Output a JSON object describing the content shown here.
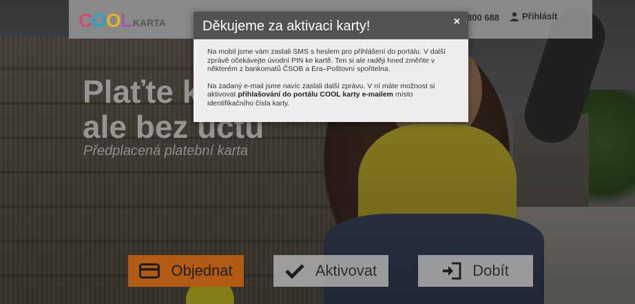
{
  "header": {
    "logo_cool": [
      "C",
      "O",
      "O",
      "L"
    ],
    "logo_karta": "KARTA",
    "phone": "800 688",
    "login_label": "Přihlásit"
  },
  "hero": {
    "title_line1": "Plaťte k",
    "title_line2": "ale bez účtu",
    "subtitle": "Předplacená platební karta"
  },
  "buttons": {
    "order": "Objednat",
    "activate": "Aktivovat",
    "topup": "Dobít"
  },
  "modal": {
    "title": "Děkujeme za aktivaci karty!",
    "close_label": "×",
    "paragraph1": "Na mobil jsme vám zaslali SMS s heslem pro přihlášení do portálu. V další zprávě očekávejte úvodní PIN ke kartě. Ten si ale raději hned změňte v některém z bankomatů ČSOB a Era–Poštovní spořitelna.",
    "paragraph2_before": "Na zadaný e-mail jsme navíc zaslali další zprávu. V ní máte možnost si aktivovat ",
    "paragraph2_bold": "přihlašování do portálu COOL karty e-mailem",
    "paragraph2_after": " místo identifikačního čísla karty."
  },
  "colors": {
    "order_button": "#b25b14",
    "modal_header": "#525252",
    "modal_body": "#eeeeee"
  },
  "icons": {
    "login": "user-icon",
    "order": "card-icon",
    "activate": "checkmark-icon",
    "topup": "sign-in-icon",
    "close": "close-icon"
  }
}
